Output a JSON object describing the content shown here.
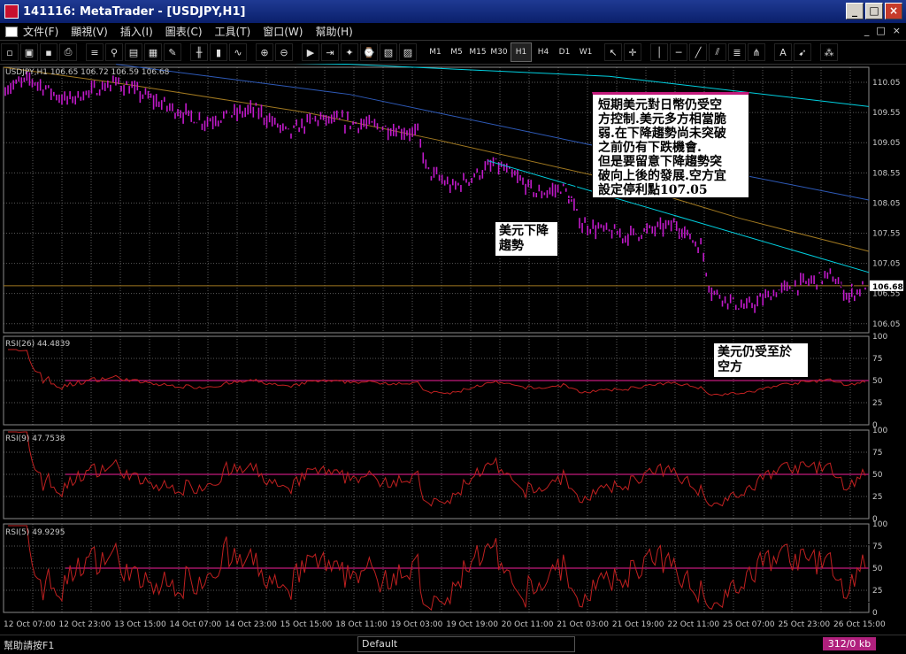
{
  "window": {
    "title": "141116: MetaTrader - [USDJPY,H1]",
    "buttons": [
      "_",
      "□",
      "×"
    ]
  },
  "menu": {
    "items": [
      "文件(F)",
      "顯視(V)",
      "插入(I)",
      "圖表(C)",
      "工具(T)",
      "窗口(W)",
      "幫助(H)"
    ],
    "mdi_buttons": [
      "_",
      "□",
      "×"
    ]
  },
  "toolbar": {
    "timeframes": [
      "M1",
      "M5",
      "M15",
      "M30",
      "H1",
      "H4",
      "D1",
      "W1"
    ],
    "active_timeframe": "H1",
    "text_tool": "A"
  },
  "chart": {
    "header": "USDJPY,H1  106.65 106.72 106.59 106.68",
    "price_ticks": [
      "110.05",
      "109.55",
      "109.05",
      "108.55",
      "108.05",
      "107.55",
      "107.05",
      "106.55",
      "106.05"
    ],
    "current_price": "106.68",
    "time_labels": [
      "12 Oct 07:00",
      "12 Oct 23:00",
      "13 Oct 15:00",
      "14 Oct 07:00",
      "14 Oct 23:00",
      "15 Oct 15:00",
      "18 Oct 11:00",
      "19 Oct 03:00",
      "19 Oct 19:00",
      "20 Oct 11:00",
      "21 Oct 03:00",
      "21 Oct 19:00",
      "22 Oct 11:00",
      "25 Oct 07:00",
      "25 Oct 23:00",
      "26 Oct 15:00"
    ]
  },
  "rsi_panels": [
    {
      "label": "RSI(26)  44.4839",
      "ticks": [
        "100",
        "75",
        "50",
        "25",
        "0"
      ]
    },
    {
      "label": "RSI(9)  47.7538",
      "ticks": [
        "100",
        "75",
        "50",
        "25",
        "0"
      ]
    },
    {
      "label": "RSI(5)  49.9295",
      "ticks": [
        "100",
        "75",
        "50",
        "25",
        "0"
      ]
    }
  ],
  "notes": {
    "main": [
      "短期美元對日幣仍受空",
      "方控制.美元多方相當脆",
      "弱.在下降趨勢尚未突破",
      "之前仍有下跌機會.",
      "但是要留意下降趨勢突",
      "破向上後的發展.空方宜",
      "設定停利點107.05"
    ],
    "downtrend": [
      "美元下降",
      "趨勢"
    ],
    "rsi": [
      "美元仍受至於",
      "空方"
    ]
  },
  "status": {
    "help": "幫助請按F1",
    "profile": "Default",
    "traffic": "312/0 kb"
  },
  "colors": {
    "background": "#000000",
    "grid": "#5a5a5a",
    "candles": "#c21acb",
    "ma_cyan": "#00d0e0",
    "ma_blue": "#2e5ab8",
    "ma_brown": "#a07820",
    "rsi_line": "#c02020",
    "rsi_level": "#c21a7b",
    "price_label_bg": "#ffffff"
  }
}
